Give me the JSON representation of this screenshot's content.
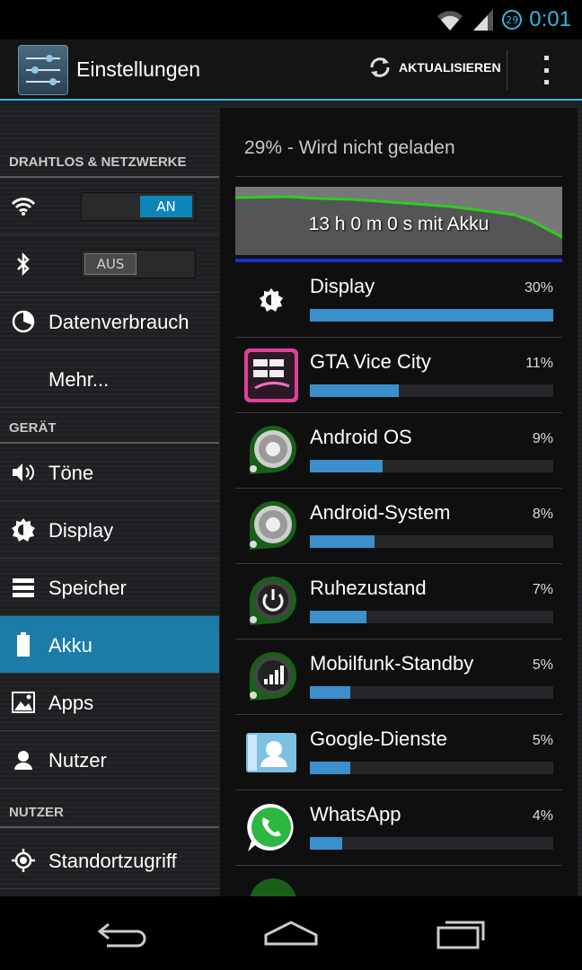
{
  "status": {
    "battery_level": "29",
    "time": "0:01"
  },
  "actionbar": {
    "title": "Einstellungen",
    "refresh_label": "AKTUALISIEREN"
  },
  "sidebar": {
    "sections": [
      {
        "label": "DRAHTLOS & NETZWERKE"
      },
      {
        "label": "GERÄT"
      },
      {
        "label": "NUTZER"
      }
    ],
    "wifi_toggle": "AN",
    "bluetooth_toggle": "AUS",
    "items": [
      {
        "label": "Datenverbrauch",
        "icon": "data-usage-icon"
      },
      {
        "label": "Mehr..."
      },
      {
        "label": "Töne",
        "icon": "speaker-icon"
      },
      {
        "label": "Display",
        "icon": "brightness-icon"
      },
      {
        "label": "Speicher",
        "icon": "storage-icon"
      },
      {
        "label": "Akku",
        "icon": "battery-icon",
        "selected": true
      },
      {
        "label": "Apps",
        "icon": "apps-icon"
      },
      {
        "label": "Nutzer",
        "icon": "user-icon"
      },
      {
        "label": "Standortzugriff",
        "icon": "location-icon"
      }
    ]
  },
  "battery": {
    "summary": "29% - Wird nicht geladen",
    "graph_label": "13 h 0 m 0 s mit Akku",
    "apps": [
      {
        "name": "Display",
        "percent": "30%",
        "value": 30,
        "icon": "brightness-icon"
      },
      {
        "name": "GTA Vice City",
        "percent": "11%",
        "value": 11,
        "icon": "gta-icon"
      },
      {
        "name": "Android OS",
        "percent": "9%",
        "value": 9,
        "icon": "android-os-icon"
      },
      {
        "name": "Android-System",
        "percent": "8%",
        "value": 8,
        "icon": "android-system-icon"
      },
      {
        "name": "Ruhezustand",
        "percent": "7%",
        "value": 7,
        "icon": "power-icon"
      },
      {
        "name": "Mobilfunk-Standby",
        "percent": "5%",
        "value": 5,
        "icon": "signal-icon"
      },
      {
        "name": "Google-Dienste",
        "percent": "5%",
        "value": 5,
        "icon": "google-services-icon"
      },
      {
        "name": "WhatsApp",
        "percent": "4%",
        "value": 4,
        "icon": "whatsapp-icon"
      }
    ]
  },
  "colors": {
    "accent": "#33b5e5",
    "selected": "#1c7ca8",
    "bar": "#3b8fcb",
    "graph_line": "#2ecc1f"
  }
}
